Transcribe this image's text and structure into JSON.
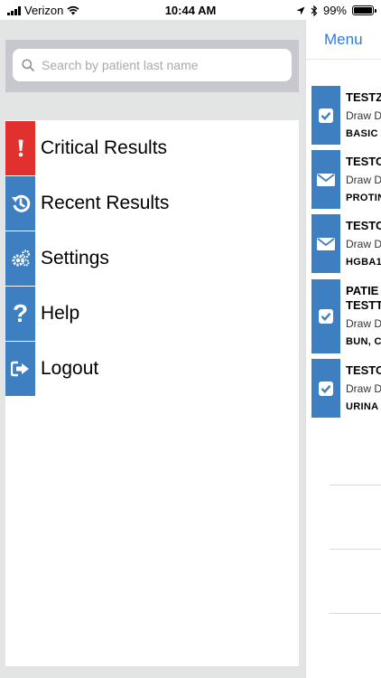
{
  "status_bar": {
    "carrier": "Verizon",
    "time": "10:44 AM",
    "battery": "99%"
  },
  "search": {
    "placeholder": "Search by patient last name"
  },
  "menu": {
    "items": [
      {
        "label": "Critical Results",
        "color": "#e0312f",
        "icon": "exclamation-icon"
      },
      {
        "label": "Recent Results",
        "color": "#3d7fc1",
        "icon": "history-icon"
      },
      {
        "label": "Settings",
        "color": "#3d7fc1",
        "icon": "gears-icon"
      },
      {
        "label": "Help",
        "color": "#3d7fc1",
        "icon": "question-icon"
      },
      {
        "label": "Logout",
        "color": "#3d7fc1",
        "icon": "logout-icon"
      }
    ]
  },
  "main": {
    "nav_button": "Menu",
    "results": [
      {
        "name": "TESTZ",
        "draw": "Draw D",
        "tests": "BASIC",
        "icon": "check-icon"
      },
      {
        "name": "TESTO",
        "draw": "Draw D",
        "tests": "PROTIN",
        "icon": "envelope-icon"
      },
      {
        "name": "TESTO",
        "draw": "Draw D",
        "tests": "HGBA1",
        "icon": "envelope-icon"
      },
      {
        "name": "PATIE",
        "name2": "TESTT",
        "draw": "Draw D",
        "tests": "BUN, C",
        "icon": "check-icon"
      },
      {
        "name": "TESTO",
        "draw": "Draw D",
        "tests": "URINA",
        "icon": "check-icon"
      }
    ]
  },
  "colors": {
    "accent": "#2f7bd8",
    "tile_blue": "#3d7fc1",
    "critical_red": "#e0312f"
  }
}
